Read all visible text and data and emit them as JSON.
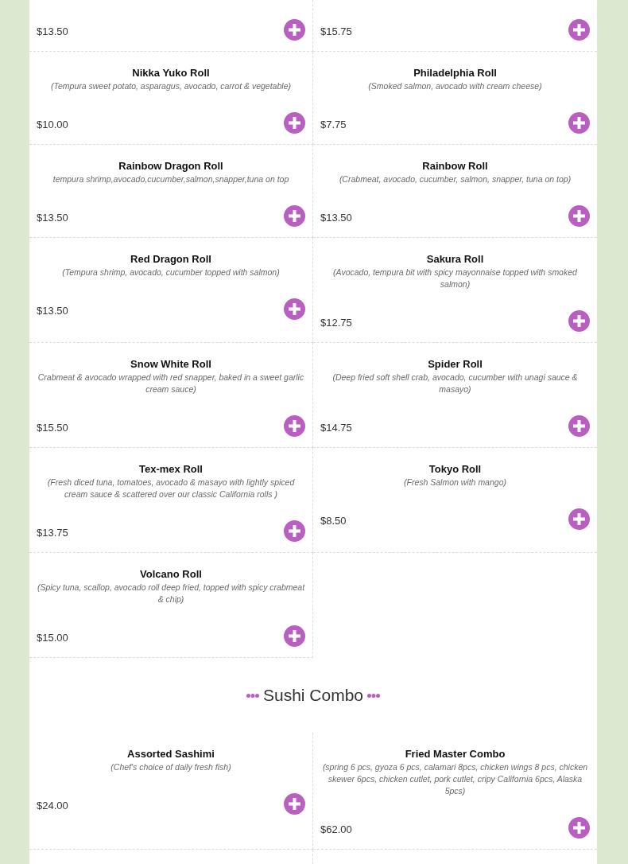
{
  "sections": [
    {
      "items": [
        {
          "price": "$13.50"
        },
        {
          "price": "$15.75"
        },
        {
          "name": "Nikka Yuko Roll",
          "description": "(Tempura sweet potato, asparagus, avocado, carrot & vegetable)",
          "price": "$10.00"
        },
        {
          "name": "Philadelphia Roll",
          "description": "(Smoked salmon, avocado with cream cheese)",
          "price": "$7.75"
        },
        {
          "name": "Rainbow Dragon Roll",
          "description": "tempura shrimp,avocado,cucumber,salmon,snapper,tuna on top",
          "price": "$13.50"
        },
        {
          "name": "Rainbow Roll",
          "description": "(Crabmeat, avocado, cucumber, salmon, snapper, tuna on top)",
          "price": "$13.50"
        },
        {
          "name": "Red Dragon Roll",
          "description": "(Tempura shrimp, avocado, cucumber topped with salmon)",
          "price": "$13.50"
        },
        {
          "name": "Sakura Roll",
          "description": "(Avocado, tempura bit with spicy mayonnaise topped with smoked salmon)",
          "price": "$12.75"
        },
        {
          "name": "Snow White Roll",
          "description": "Crabmeat & avocado wrapped with red snapper, baked in a sweet garlic cream sauce)",
          "price": "$15.50"
        },
        {
          "name": "Spider Roll",
          "description": "(Deep fried soft shell crab, avocado, cucumber with unagi sauce & masayo)",
          "price": "$14.75"
        },
        {
          "name": "Tex-mex Roll",
          "description": "(Fresh diced tuna, tomatoes, avocado & masayo with lightly spiced cream sauce & scattered over our classic California rolls )",
          "price": "$13.75"
        },
        {
          "name": "Tokyo Roll",
          "description": "(Fresh Salmon with mango)",
          "price": "$8.50"
        },
        {
          "name": "Volcano Roll",
          "description": "(Spicy tuna, scallop, avocado roll deep fried, topped with spicy crabmeat & chip)",
          "price": "$15.00"
        }
      ]
    },
    {
      "title": "Sushi Combo",
      "items": [
        {
          "name": "Assorted Sashimi",
          "description": "(Chef's choice of daily fresh fish)",
          "price": "$24.00"
        },
        {
          "name": "Fried Master Combo",
          "description": "(spring 6 pcs, gyoza 6 pcs, calamari 8pcs, chicken wings 8 pcs, chicken skewer 6pcs, chicken cutlet, pork cutlet, cripy California 6pcs, Alaska 5pcs)",
          "price": "$62.00"
        }
      ]
    }
  ]
}
